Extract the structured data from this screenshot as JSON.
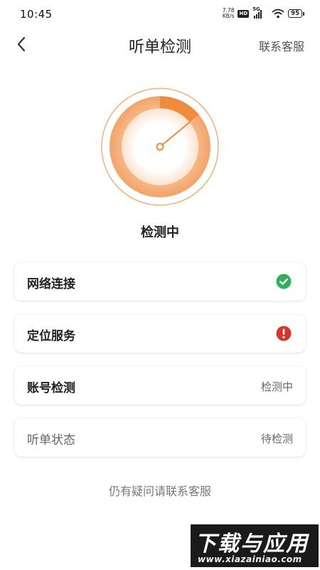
{
  "status_bar": {
    "time": "10:45",
    "net_speed_value": "7.78",
    "net_speed_unit": "KB/s",
    "hd_label": "HD",
    "network_label": "5G",
    "battery": "95"
  },
  "header": {
    "back_icon": "chevron-left-icon",
    "title": "听单检测",
    "contact": "联系客服"
  },
  "gauge": {
    "status_text": "检测中",
    "progress": 0.14,
    "accent_color": "#f08a3c",
    "light_color": "#fbd9bd"
  },
  "checks": [
    {
      "label": "网络连接",
      "status_icon": "check-circle-icon",
      "status_color": "#2fb05a"
    },
    {
      "label": "定位服务",
      "status_icon": "error-circle-icon",
      "status_color": "#d9342b"
    },
    {
      "label": "账号检测",
      "status": "检测中"
    },
    {
      "label": "听单状态",
      "status": "待检测"
    }
  ],
  "footer": {
    "help_text": "仍有疑问请联系客服"
  },
  "watermark": {
    "main": "下载与应用",
    "url": "www.xiazainiao.com"
  }
}
